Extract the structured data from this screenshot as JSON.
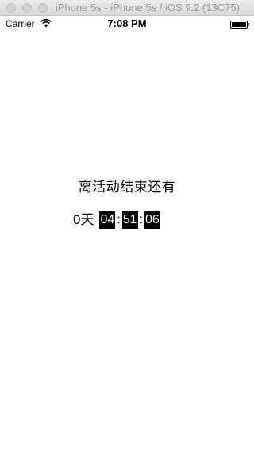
{
  "titlebar": {
    "title": "iPhone 5s - iPhone 5s / iOS 9.2 (13C75)"
  },
  "statusbar": {
    "carrier": "Carrier",
    "time": "7:08 PM",
    "icons": [
      "wifi-icon",
      "battery-icon"
    ]
  },
  "content": {
    "label": "离活动结束还有",
    "days_text": "0天",
    "hours": "04",
    "minutes": "51",
    "seconds": "06",
    "separator": ":"
  },
  "colors": {
    "box_background": "#000000",
    "box_text": "#ffffff",
    "page_background": "#ffffff"
  }
}
